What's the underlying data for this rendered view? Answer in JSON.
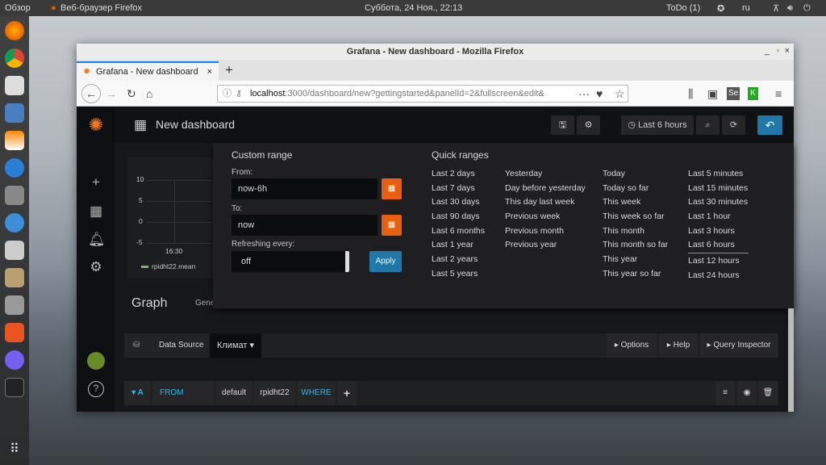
{
  "desktop": {
    "activities": "Обзор",
    "app_menu": "Веб-браузер Firefox",
    "clock": "Суббота, 24 Ноя., 22:13",
    "todo": "ToDo (1)",
    "lang": "ru"
  },
  "window": {
    "title": "Grafana - New dashboard - Mozilla Firefox",
    "tab_title": "Grafana - New dashboard",
    "url_host": "localhost",
    "url_rest": ":3000/dashboard/new?gettingstarted&panelId=2&fullscreen&edit&"
  },
  "grafana": {
    "dashboard_title": "New dashboard",
    "time_picker_label": "Last 6 hours",
    "graph": {
      "y_ticks": [
        "10",
        "5",
        "0",
        "-5"
      ],
      "x_tick": "16:30",
      "legend": "rpidht22.mean",
      "series_color": "#7eb26d"
    },
    "panel_title": "Graph",
    "panel_tab": "General",
    "custom_range": {
      "title": "Custom range",
      "from_label": "From:",
      "from_value": "now-6h",
      "to_label": "To:",
      "to_value": "now",
      "refresh_label": "Refreshing every:",
      "refresh_value": "off",
      "apply": "Apply"
    },
    "quick_ranges": {
      "title": "Quick ranges",
      "columns": [
        [
          "Last 2 days",
          "Last 7 days",
          "Last 30 days",
          "Last 90 days",
          "Last 6 months",
          "Last 1 year",
          "Last 2 years",
          "Last 5 years"
        ],
        [
          "Yesterday",
          "Day before yesterday",
          "This day last week",
          "Previous week",
          "Previous month",
          "Previous year"
        ],
        [
          "Today",
          "Today so far",
          "This week",
          "This week so far",
          "This month",
          "This month so far",
          "This year",
          "This year so far"
        ],
        [
          "Last 5 minutes",
          "Last 15 minutes",
          "Last 30 minutes",
          "Last 1 hour",
          "Last 3 hours",
          "Last 6 hours",
          "Last 12 hours",
          "Last 24 hours"
        ]
      ],
      "selected": "Last 6 hours"
    },
    "datasource": {
      "label": "Data Source",
      "value": "Климат",
      "options": "Options",
      "help": "Help",
      "inspector": "Query Inspector"
    },
    "query": {
      "ref": "A",
      "from": "FROM",
      "policy": "default",
      "measurement": "rpidht22",
      "where": "WHERE",
      "add": "+"
    }
  }
}
